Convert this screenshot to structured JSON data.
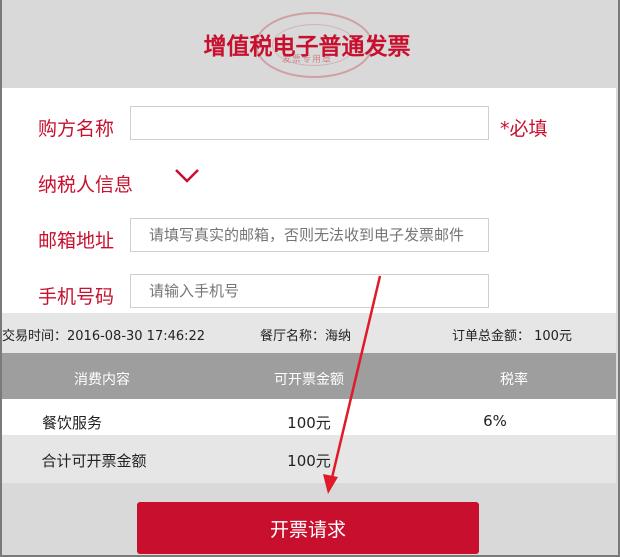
{
  "header": {
    "title": "增值税电子普通发票",
    "seal_text": "发票专用章"
  },
  "form": {
    "buyer_name": {
      "label": "购方名称",
      "value": "",
      "placeholder": "",
      "required_label": "*必填"
    },
    "taxpayer_info": {
      "label": "纳税人信息",
      "expand_icon": "chevron-down-icon"
    },
    "email": {
      "label": "邮箱地址",
      "value": "",
      "placeholder": "请填写真实的邮箱，否则无法收到电子发票邮件"
    },
    "phone": {
      "label": "手机号码",
      "value": "",
      "placeholder": "请输入手机号"
    }
  },
  "order_info": {
    "transaction_time": "交易时间：2016-08-30 17:46:22",
    "restaurant": "餐厅名称：海纳",
    "total_amount": "订单总金额： 100元"
  },
  "table": {
    "headers": [
      "消费内容",
      "可开票金额",
      "税率"
    ],
    "rows": [
      {
        "item": "餐饮服务",
        "amount": "100元",
        "tax_rate": "6%"
      }
    ],
    "total": {
      "label": "合计可开票金额",
      "amount": "100元"
    }
  },
  "submit_button": {
    "label": "开票请求"
  },
  "colors": {
    "accent": "#c8102e",
    "table_header": "#9e9e9e",
    "background": "#d9d9d9"
  }
}
